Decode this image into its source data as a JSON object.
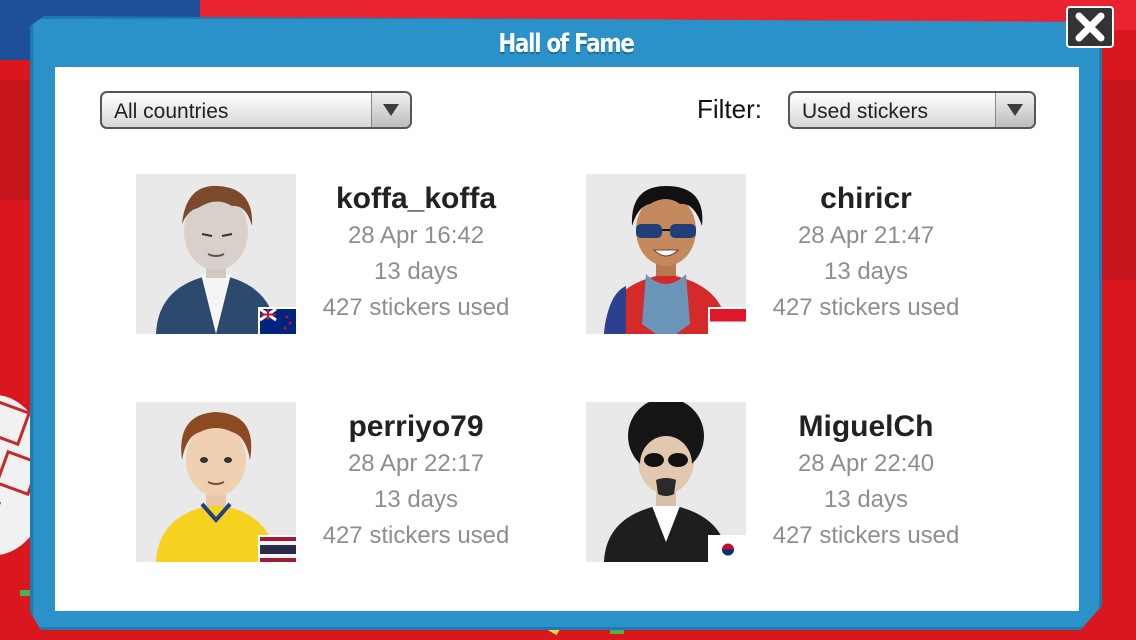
{
  "modal": {
    "title": "Hall of Fame"
  },
  "filters": {
    "country_value": "All countries",
    "filter_label": "Filter:",
    "filter_value": "Used stickers"
  },
  "players": [
    {
      "name": "koffa_koffa",
      "date": "28 Apr 16:42",
      "days": "13 days",
      "stickers": "427 stickers used",
      "flag": "new-zealand"
    },
    {
      "name": "chiricr",
      "date": "28 Apr 21:47",
      "days": "13 days",
      "stickers": "427 stickers used",
      "flag": "indonesia"
    },
    {
      "name": "perriyo79",
      "date": "28 Apr 22:17",
      "days": "13 days",
      "stickers": "427 stickers used",
      "flag": "thailand"
    },
    {
      "name": "MiguelCh",
      "date": "28 Apr 22:40",
      "days": "13 days",
      "stickers": "427 stickers used",
      "flag": "korea"
    }
  ],
  "colors": {
    "modal_blue": "#2a91c9",
    "background_red": "#d8171f"
  },
  "icons": {
    "close": "close-x-icon",
    "dropdown": "chevron-down-icon"
  }
}
